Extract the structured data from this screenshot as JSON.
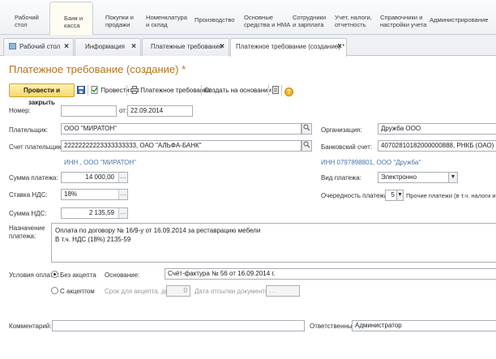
{
  "sections": [
    {
      "label": "Рабочий\nстол"
    },
    {
      "label": "Банк и\nкасса"
    },
    {
      "label": "Покупки и\nпродажи"
    },
    {
      "label": "Номенклатура\nи склад"
    },
    {
      "label": "Производство"
    },
    {
      "label": "Основные\nсредства и НМА"
    },
    {
      "label": "Сотрудники\nи зарплата"
    },
    {
      "label": "Учет, налоги,\nотчетность"
    },
    {
      "label": "Справочники и\nнастройки учета"
    },
    {
      "label": "Администрирование"
    }
  ],
  "tabs": [
    {
      "label": "Рабочий стол"
    },
    {
      "label": "Информация"
    },
    {
      "label": "Платежные требования"
    },
    {
      "label": "Платежное требование (создание) *"
    }
  ],
  "doc": {
    "title": "Платежное требование (создание) *"
  },
  "toolbar": {
    "post_close": "Провести и закрыть",
    "post": "Провести",
    "payment_request": "Платежное требование",
    "create_based": "Создать на основании",
    "help": "?"
  },
  "form": {
    "number_label": "Номер:",
    "number_value": "",
    "date_label": "от:",
    "date_value": "22.09.2014",
    "payer_label": "Плательщик:",
    "payer_value": "ООО \"МИРАТОН\"",
    "payer_account_label": "Счет плательщика:",
    "payer_account_value": "22222222223333333333, ОАО \"АЛЬФА-БАНК\"",
    "payer_inn": "ИНН , ООО \"МИРАТОН\"",
    "org_label": "Организация:",
    "org_value": "Дружба ООО",
    "bank_account_label": "Банковский счет:",
    "bank_account_value": "40702810182000000888, РНКБ (ОАО)",
    "org_inn": "ИНН 0797898801, ООО \"Дружба\"",
    "amount_label": "Сумма платежа:",
    "amount_value": "14 000,00",
    "vat_rate_label": "Ставка НДС:",
    "vat_rate_value": "18%",
    "vat_sum_label": "Сумма НДС:",
    "vat_sum_value": "2 135,59",
    "pay_kind_label": "Вид платежа:",
    "pay_kind_value": "Электронно",
    "priority_label": "Очередность платежа:",
    "priority_value": "5",
    "priority_note": "Прочие платежи (в т.ч. налоги и взн",
    "purpose_label": "Назначение\nплатежа:",
    "purpose_line1": "Оплата по договору № 16/9-у от 16.09.2014 за реставрацию мебели",
    "purpose_line2": "В т.ч. НДС  (18%) 2135-59",
    "terms_label": "Условия оплаты:",
    "no_acceptance": "Без акцепта",
    "with_acceptance": "С акцептом",
    "basis_label": "Основание:",
    "basis_value": "Счёт-фактура № 56 от 16.09.2014 г.",
    "accept_days_label": "Срок для акцепта, дней:",
    "accept_days_value": "0",
    "send_date_label": "Дата отсылки документов:",
    "send_date_value": ". .",
    "comment_label": "Комментарий:",
    "comment_value": "",
    "responsible_label": "Ответственный:",
    "responsible_value": "Администратор"
  }
}
